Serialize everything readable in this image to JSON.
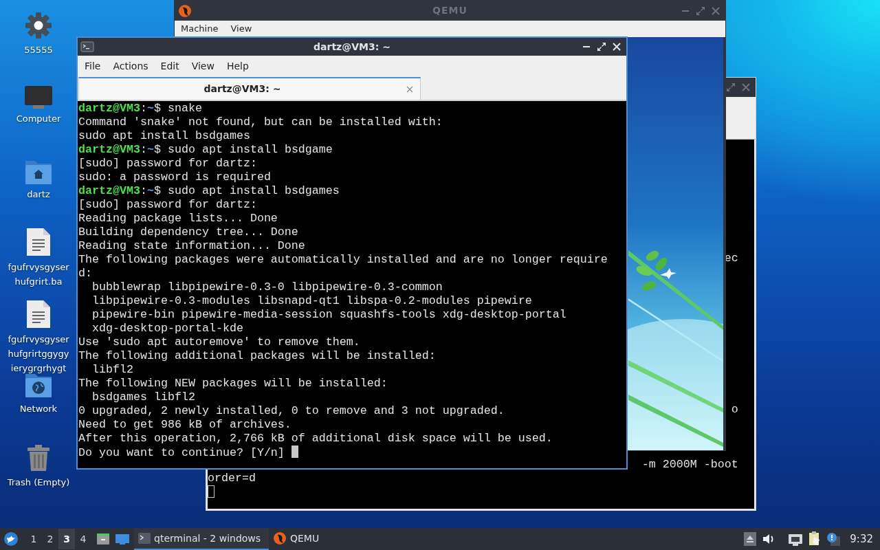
{
  "desktop_icons": [
    {
      "kind": "settings",
      "label_lines": [
        "55555"
      ]
    },
    {
      "kind": "computer",
      "label_lines": [
        "Computer"
      ]
    },
    {
      "kind": "home-folder",
      "label_lines": [
        "dartz"
      ]
    },
    {
      "kind": "document",
      "label_lines": [
        "fgufrvysgyser",
        "hufgrirt.ba"
      ]
    },
    {
      "kind": "document",
      "label_lines": [
        "fgufrvysgyser",
        "hufgrirtggygy",
        "ierygrgrhygt"
      ]
    },
    {
      "kind": "network-folder",
      "label_lines": [
        "Network"
      ]
    },
    {
      "kind": "trash",
      "label_lines": [
        "Trash (Empty)"
      ]
    }
  ],
  "back_terminal": {
    "focused": false,
    "lines": [
      {
        "kind": "fragment",
        "text": "ec"
      },
      {
        "kind": "fragment",
        "text": "o"
      },
      {
        "kind": "fragment",
        "text": "-m 2000M -boot"
      },
      {
        "kind": "output",
        "text": "order=d"
      },
      {
        "kind": "cursor"
      }
    ]
  },
  "qemu_window": {
    "title": "QEMU",
    "focused": false,
    "menu": [
      "Machine",
      "View"
    ],
    "display": {
      "kind": "picture"
    }
  },
  "terminal_window": {
    "title": "dartz@VM3: ~",
    "focused": true,
    "menu": [
      "File",
      "Actions",
      "Edit",
      "View",
      "Help"
    ],
    "tabs": [
      {
        "label": "dartz@VM3: ~",
        "selected": true
      }
    ],
    "lines": [
      {
        "kind": "prompt",
        "user": "dartz@VM3",
        "sep": ":",
        "path": "~",
        "command": "$ snake"
      },
      {
        "kind": "output",
        "text": "Command 'snake' not found, but can be installed with:"
      },
      {
        "kind": "output",
        "text": "sudo apt install bsdgames"
      },
      {
        "kind": "prompt",
        "user": "dartz@VM3",
        "sep": ":",
        "path": "~",
        "command": "$ sudo apt install bsdgame"
      },
      {
        "kind": "output",
        "text": "[sudo] password for dartz:"
      },
      {
        "kind": "output",
        "text": "sudo: a password is required"
      },
      {
        "kind": "prompt",
        "user": "dartz@VM3",
        "sep": ":",
        "path": "~",
        "command": "$ sudo apt install bsdgames"
      },
      {
        "kind": "output",
        "text": "[sudo] password for dartz:"
      },
      {
        "kind": "output",
        "text": "Reading package lists... Done"
      },
      {
        "kind": "output",
        "text": "Building dependency tree... Done"
      },
      {
        "kind": "output",
        "text": "Reading state information... Done"
      },
      {
        "kind": "output",
        "text": "The following packages were automatically installed and are no longer require"
      },
      {
        "kind": "output",
        "text": "d:"
      },
      {
        "kind": "output",
        "text": "  bubblewrap libpipewire-0.3-0 libpipewire-0.3-common"
      },
      {
        "kind": "output",
        "text": "  libpipewire-0.3-modules libsnapd-qt1 libspa-0.2-modules pipewire"
      },
      {
        "kind": "output",
        "text": "  pipewire-bin pipewire-media-session squashfs-tools xdg-desktop-portal"
      },
      {
        "kind": "output",
        "text": "  xdg-desktop-portal-kde"
      },
      {
        "kind": "output",
        "text": "Use 'sudo apt autoremove' to remove them."
      },
      {
        "kind": "output",
        "text": "The following additional packages will be installed:"
      },
      {
        "kind": "output",
        "text": "  libfl2"
      },
      {
        "kind": "output",
        "text": "The following NEW packages will be installed:"
      },
      {
        "kind": "output",
        "text": "  bsdgames libfl2"
      },
      {
        "kind": "output",
        "text": "0 upgraded, 2 newly installed, 0 to remove and 3 not upgraded."
      },
      {
        "kind": "output",
        "text": "Need to get 986 kB of archives."
      },
      {
        "kind": "output",
        "text": "After this operation, 2,766 kB of additional disk space will be used."
      },
      {
        "kind": "input",
        "text": "Do you want to continue? [Y/n] "
      }
    ]
  },
  "taskbar": {
    "workspaces": [
      {
        "label": "1",
        "selected": false
      },
      {
        "label": "2",
        "selected": false
      },
      {
        "label": "3",
        "selected": true
      },
      {
        "label": "4",
        "selected": false
      }
    ],
    "tasks": [
      {
        "kind": "terminal",
        "label": "qterminal - 2 windows",
        "selected": true
      },
      {
        "kind": "qemu",
        "label": "QEMU",
        "selected": false
      }
    ],
    "clock": "9:32"
  }
}
